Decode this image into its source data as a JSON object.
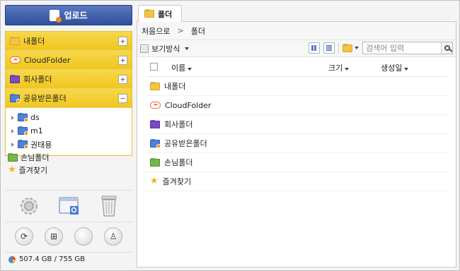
{
  "sidebar": {
    "upload_label": "업로드",
    "tree": [
      {
        "label": "내폴더",
        "icon": "folder-yellow-icon",
        "toggle": "+"
      },
      {
        "label": "CloudFolder",
        "icon": "cloud-folder-icon",
        "toggle": "+"
      },
      {
        "label": "회사폴더",
        "icon": "folder-purple-icon",
        "toggle": "+"
      },
      {
        "label": "공유받은폴더",
        "icon": "folder-shared-icon",
        "toggle": "−"
      }
    ],
    "shared_children": [
      "ds",
      "m1",
      "권태용"
    ],
    "extras": [
      {
        "label": "손님폴더",
        "icon": "folder-green-icon"
      },
      {
        "label": "즐겨찾기",
        "icon": "star-icon"
      }
    ],
    "tools": [
      "settings-icon",
      "window-search-icon",
      "trash-icon"
    ],
    "sync_buttons": [
      "sync-icon",
      "windows-icon",
      "apple-icon",
      "android-icon"
    ],
    "storage": "507.4 GB / 755 GB"
  },
  "tab": {
    "label": "폴더"
  },
  "breadcrumb": {
    "home": "처음으로",
    "sep": ">",
    "current": "폴더"
  },
  "toolbar": {
    "view_label": "보기방식",
    "search_placeholder": "검색어 입력"
  },
  "columns": {
    "name": "이름",
    "size": "크기",
    "date": "생성일"
  },
  "rows": [
    {
      "label": "내폴더",
      "icon": "folder-yellow-icon"
    },
    {
      "label": "CloudFolder",
      "icon": "cloud-folder-icon"
    },
    {
      "label": "회사폴더",
      "icon": "folder-purple-icon"
    },
    {
      "label": "공유받은폴더",
      "icon": "folder-shared-icon"
    },
    {
      "label": "손님폴더",
      "icon": "folder-green-icon"
    },
    {
      "label": "즐겨찾기",
      "icon": "star-icon"
    }
  ],
  "colors": {
    "accent_yellow": "#f0c61f",
    "upload_blue": "#2f4f9a"
  }
}
